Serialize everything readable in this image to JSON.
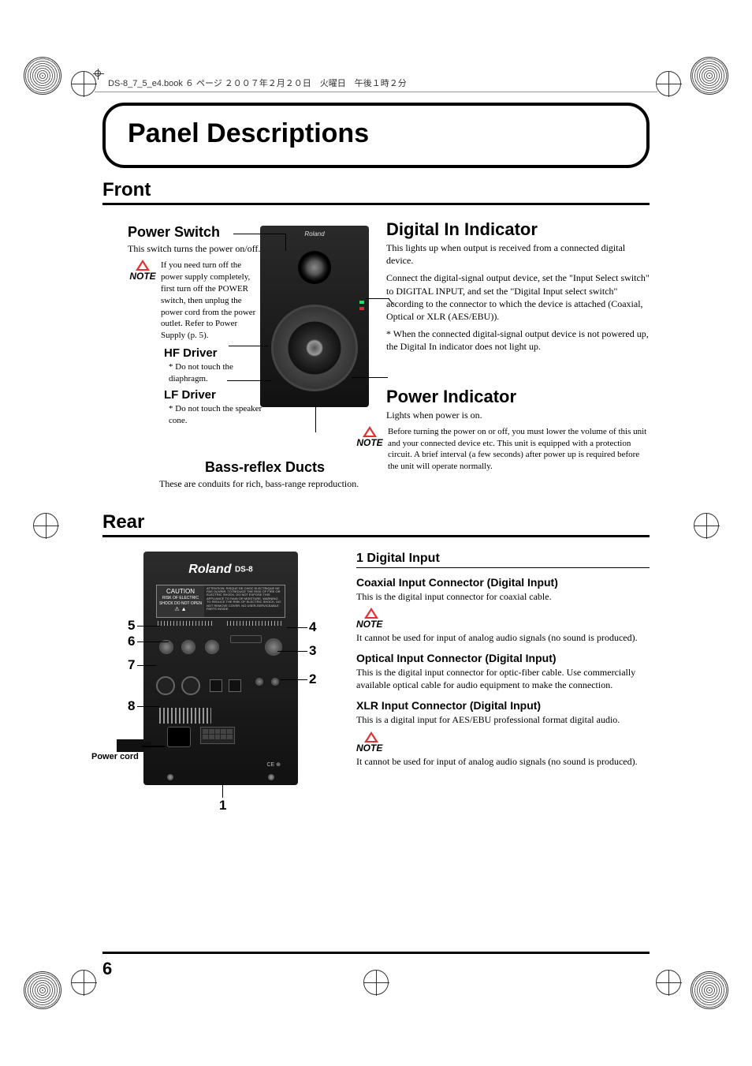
{
  "header_line": "DS-8_7_5_e4.book ６ ページ ２００７年２月２０日　火曜日　午後１時２分",
  "page_number": "6",
  "title": "Panel Descriptions",
  "sections": {
    "front": {
      "heading": "Front",
      "power_switch": {
        "title": "Power Switch",
        "body": "This switch turns the power on/off.",
        "note": "If you need turn off the power supply completely, first turn off the POWER switch, then unplug the power cord from the power outlet. Refer to Power Supply (p. 5)."
      },
      "hf_driver": {
        "title": "HF Driver",
        "note": "* Do not touch the diaphragm."
      },
      "lf_driver": {
        "title": "LF Driver",
        "note": "* Do not touch the speaker cone."
      },
      "bass_reflex": {
        "title": "Bass-reflex Ducts",
        "body": "These are conduits for rich, bass-range reproduction."
      },
      "digital_in": {
        "title": "Digital In Indicator",
        "p1": "This lights up when output is received from a connected digital device.",
        "p2": "Connect the digital-signal output device, set the \"Input Select switch\" to DIGITAL INPUT, and set the \"Digital Input select switch\" according to the connector to which the device is attached (Coaxial, Optical or XLR (AES/EBU)).",
        "p3": "* When the connected digital-signal output device is not powered up, the Digital In indicator does not light up."
      },
      "power_indicator": {
        "title": "Power Indicator",
        "body": "Lights when power is on.",
        "note": "Before turning the power on or off, you must lower the volume of this unit and your connected device etc. This unit is equipped with a protection circuit. A brief interval (a few seconds) after power up is required before the unit will operate normally."
      }
    },
    "rear": {
      "heading": "Rear",
      "logo": "Roland",
      "model": "DS-8",
      "warn_caution": "CAUTION",
      "warn_risk": "RISK OF ELECTRIC SHOCK DO NOT OPEN",
      "ce": "CE",
      "power_cord_label": "Power cord",
      "numbers": [
        "1",
        "2",
        "3",
        "4",
        "5",
        "6",
        "7",
        "8"
      ],
      "section1": {
        "heading": "1 Digital Input",
        "coax": {
          "title": "Coaxial Input Connector (Digital Input)",
          "body": "This is the digital input connector for coaxial cable.",
          "note": "It cannot be used for input of analog audio signals (no sound is produced)."
        },
        "optical": {
          "title": "Optical Input Connector (Digital Input)",
          "body": "This is the digital input connector for optic-fiber cable. Use commercially available optical cable for audio equipment to make the connection."
        },
        "xlr": {
          "title": "XLR Input Connector (Digital Input)",
          "body": "This is a digital input for AES/EBU professional format digital audio.",
          "note": "It cannot be used for input of analog audio signals (no sound is produced)."
        }
      }
    }
  },
  "note_label": "NOTE"
}
